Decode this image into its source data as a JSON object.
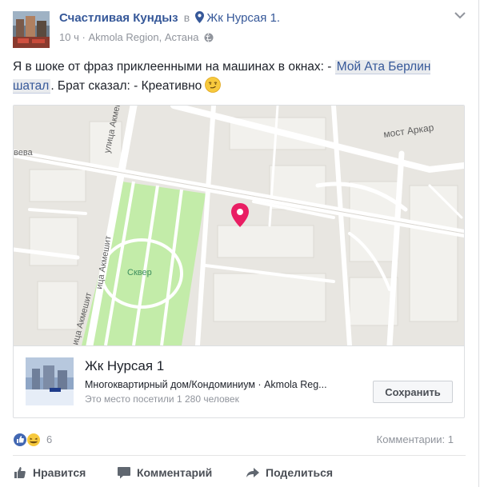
{
  "post": {
    "author": "Счастливая Кундыз",
    "in_word": "в",
    "place": "Жк Нурсая 1.",
    "time": "10 ч",
    "location_meta": "Akmola Region, Астана",
    "text_part1": "Я в шоке от фраз приклеенными на машинах в окнах: - ",
    "text_highlight": "Мой Ата Берлин шатал",
    "text_part2": ". Брат сказал: - Креативно",
    "emoji": "smirk-emoji"
  },
  "map": {
    "label_bridge": "мост Аркар",
    "label_street_top": "улица Акмеши",
    "label_street_bottom": "ица Акмешит",
    "label_street_left": "ица Акмешит",
    "label_park": "Сквер",
    "label_edge": "вева",
    "pin_color": "#e91e63",
    "park_color": "#c3eca9"
  },
  "place_card": {
    "title": "Жк Нурсая 1",
    "subtitle": "Многоквартирный дом/Кондоминиум · Akmola Reg...",
    "visits": "Это место посетили 1 280 человек",
    "save_label": "Сохранить"
  },
  "stats": {
    "reaction_count": "6",
    "comments": "Комментарии: 1"
  },
  "actions": {
    "like": "Нравится",
    "comment": "Комментарий",
    "share": "Поделиться"
  },
  "colors": {
    "link": "#365899",
    "muted": "#90949c"
  }
}
